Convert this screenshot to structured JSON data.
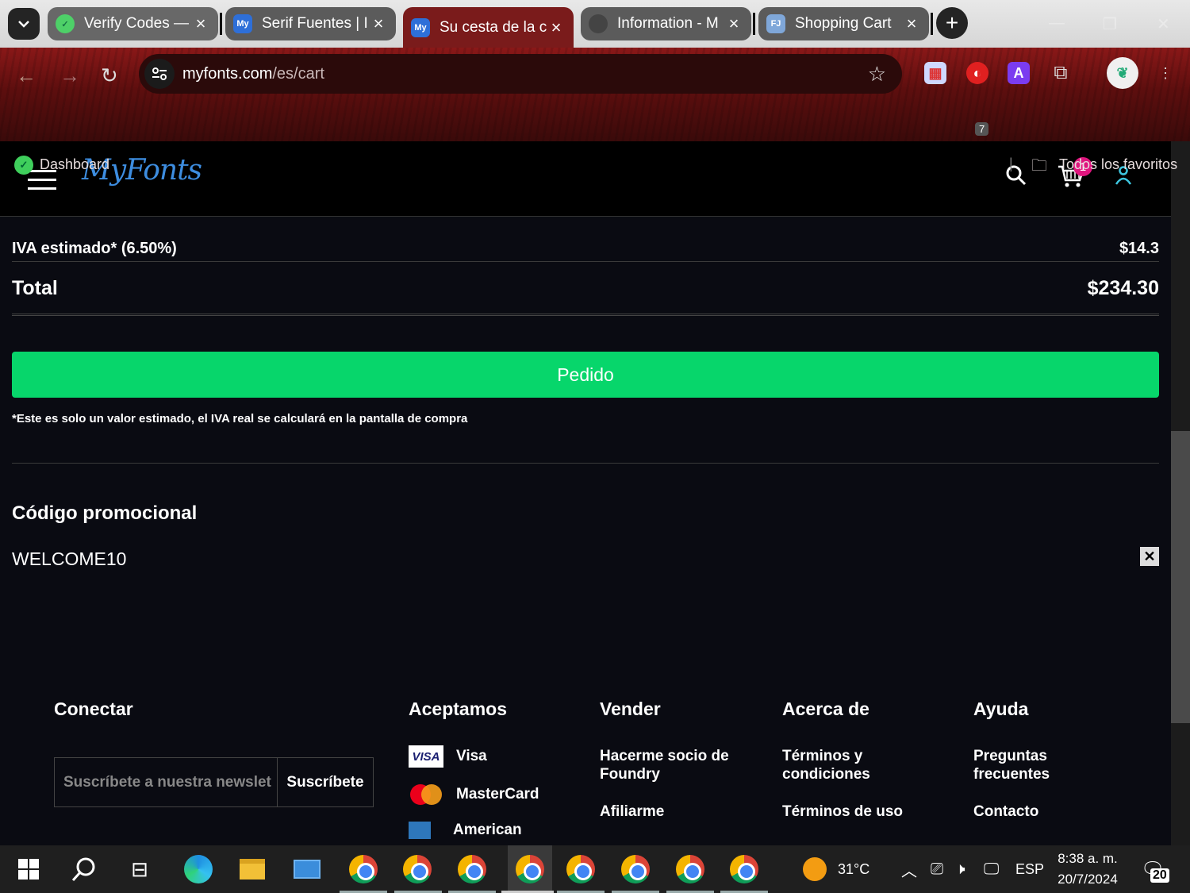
{
  "browser": {
    "tabs": [
      {
        "title": "Verify Codes —",
        "fav": "shield-check-icon",
        "active": false
      },
      {
        "title": "Serif Fuentes | I",
        "fav": "myfonts-icon",
        "active": false
      },
      {
        "title": "Su cesta de la c",
        "fav": "myfonts-icon",
        "active": true
      },
      {
        "title": "Information - M",
        "fav": "globe-icon",
        "active": false
      },
      {
        "title": "Shopping Cart",
        "fav": "fj-icon",
        "active": false
      }
    ],
    "url_host": "myfonts.com",
    "url_path": "/es/cart",
    "bookmarks": {
      "dashboard": "Dashboard",
      "all_favorites": "Todos los favoritos"
    },
    "ext_badge": "7"
  },
  "site": {
    "logo": "MyFonts",
    "cart_count": "1"
  },
  "cart": {
    "vat_label": "IVA estimado* (6.50%)",
    "vat_value": "$14.3",
    "total_label": "Total",
    "total_value": "$234.30",
    "order_button": "Pedido",
    "vat_note": "*Este es solo un valor estimado, el IVA real se calculará en la pantalla de compra",
    "promo_title": "Código promocional",
    "promo_code": "WELCOME10"
  },
  "footer": {
    "connect": {
      "title": "Conectar",
      "placeholder": "Suscríbete a nuestra newslet",
      "button": "Suscríbete"
    },
    "accept": {
      "title": "Aceptamos",
      "items": [
        "Visa",
        "MasterCard",
        "American"
      ]
    },
    "sell": {
      "title": "Vender",
      "items": [
        "Hacerme socio de Foundry",
        "Afiliarme"
      ]
    },
    "about": {
      "title": "Acerca de",
      "items": [
        "Términos y condiciones",
        "Términos de uso"
      ]
    },
    "help": {
      "title": "Ayuda",
      "items": [
        "Preguntas frecuentes",
        "Contacto"
      ]
    }
  },
  "taskbar": {
    "temperature": "31°C",
    "language": "ESP",
    "time": "8:38 a. m.",
    "date": "20/7/2024",
    "notifications": "20"
  },
  "colors": {
    "accent_green": "#07d66b",
    "logo_blue": "#3d8de0",
    "badge_pink": "#e0157e",
    "chrome_red": "#7a1b1b"
  }
}
